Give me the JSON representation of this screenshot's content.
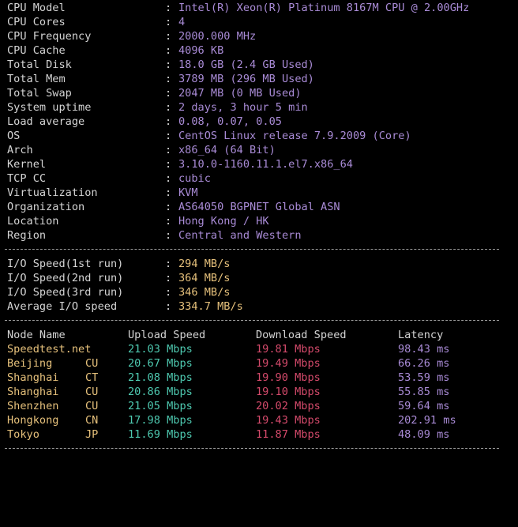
{
  "system_info": [
    {
      "label": "CPU Model",
      "value": "Intel(R) Xeon(R) Platinum 8167M CPU @ 2.00GHz"
    },
    {
      "label": "CPU Cores",
      "value": "4"
    },
    {
      "label": "CPU Frequency",
      "value": "2000.000 MHz"
    },
    {
      "label": "CPU Cache",
      "value": "4096 KB"
    },
    {
      "label": "Total Disk",
      "value": "18.0 GB (2.4 GB Used)"
    },
    {
      "label": "Total Mem",
      "value": "3789 MB (296 MB Used)"
    },
    {
      "label": "Total Swap",
      "value": "2047 MB (0 MB Used)"
    },
    {
      "label": "System uptime",
      "value": "2 days, 3 hour 5 min"
    },
    {
      "label": "Load average",
      "value": "0.08, 0.07, 0.05"
    },
    {
      "label": "OS",
      "value": "CentOS Linux release 7.9.2009 (Core)"
    },
    {
      "label": "Arch",
      "value": "x86_64 (64 Bit)"
    },
    {
      "label": "Kernel",
      "value": "3.10.0-1160.11.1.el7.x86_64"
    },
    {
      "label": "TCP CC",
      "value": "cubic"
    },
    {
      "label": "Virtualization",
      "value": "KVM"
    },
    {
      "label": "Organization",
      "value": "AS64050 BGPNET Global ASN"
    },
    {
      "label": "Location",
      "value": "Hong Kong / HK"
    },
    {
      "label": "Region",
      "value": "Central and Western"
    }
  ],
  "colon": ":",
  "io_speed": [
    {
      "label": "I/O Speed(1st run)",
      "value": "294 MB/s"
    },
    {
      "label": "I/O Speed(2nd run)",
      "value": "364 MB/s"
    },
    {
      "label": "I/O Speed(3rd run)",
      "value": "346 MB/s"
    },
    {
      "label": "Average I/O speed",
      "value": "334.7 MB/s"
    }
  ],
  "speedtest": {
    "headers": {
      "node": "Node Name",
      "upload": "Upload Speed",
      "download": "Download Speed",
      "latency": "Latency"
    },
    "rows": [
      {
        "node": "Speedtest.net",
        "isp": "",
        "upload": "21.03 Mbps",
        "download": "19.81 Mbps",
        "latency": "98.43 ms"
      },
      {
        "node": "Beijing",
        "isp": "CU",
        "upload": "20.67 Mbps",
        "download": "19.49 Mbps",
        "latency": "66.26 ms"
      },
      {
        "node": "Shanghai",
        "isp": "CT",
        "upload": "21.08 Mbps",
        "download": "19.90 Mbps",
        "latency": "53.59 ms"
      },
      {
        "node": "Shanghai",
        "isp": "CU",
        "upload": "20.86 Mbps",
        "download": "19.10 Mbps",
        "latency": "55.85 ms"
      },
      {
        "node": "Shenzhen",
        "isp": "CU",
        "upload": "21.05 Mbps",
        "download": "20.02 Mbps",
        "latency": "59.64 ms"
      },
      {
        "node": "Hongkong",
        "isp": "CN",
        "upload": "17.98 Mbps",
        "download": "19.43 Mbps",
        "latency": "202.91 ms"
      },
      {
        "node": "Tokyo",
        "isp": "JP",
        "upload": "11.69 Mbps",
        "download": "11.87 Mbps",
        "latency": "48.09 ms"
      }
    ]
  },
  "colors": {
    "background": "#000000",
    "label": "#d4d4d4",
    "value": "#a98bd6",
    "io_value": "#e5c07b",
    "node": "#e5c07b",
    "upload": "#4ec9b0",
    "download": "#d44a6b",
    "latency": "#a98bd6"
  }
}
